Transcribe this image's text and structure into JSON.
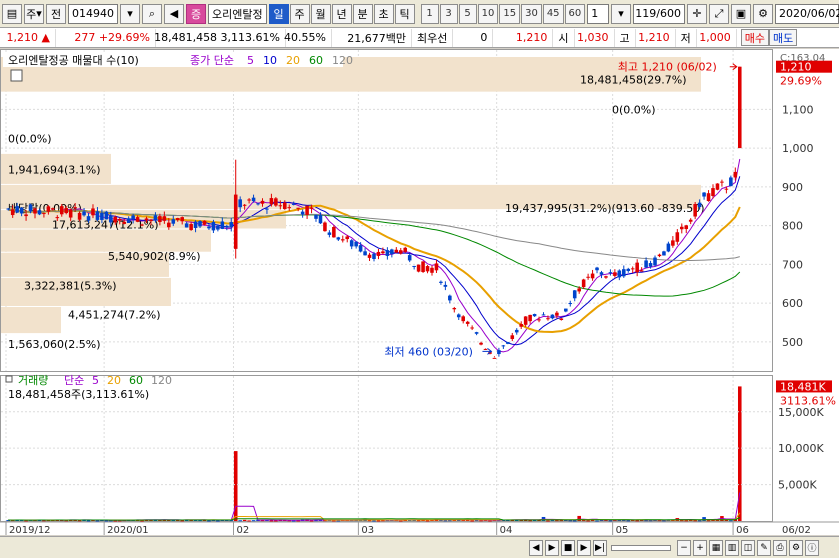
{
  "toolbar": {
    "type_label": "주",
    "all_label": "전",
    "code": "014940",
    "badge": "증",
    "stock_name": "오리엔탈정",
    "periods": [
      "일",
      "주",
      "월",
      "년",
      "분",
      "초",
      "틱"
    ],
    "active_period": "일",
    "intervals": [
      "1",
      "3",
      "5",
      "10",
      "15",
      "30",
      "45",
      "60"
    ],
    "interval_value": "1",
    "count": "119/600",
    "date": "2020/06/02"
  },
  "quote": {
    "price": "1,210",
    "change": "277 +29.69%",
    "volume": "18,481,458 3,113.61%",
    "turnover": "40.55%",
    "amount": "21,677백만",
    "best_label": "최우선",
    "best_value": "0",
    "price2": "1,210",
    "open_label": "시",
    "open": "1,030",
    "high_label": "고",
    "high": "1,210",
    "low_label": "저",
    "low": "1,000",
    "buy_label": "매수",
    "sell_label": "매도"
  },
  "price_panel": {
    "legend_name": "오리엔탈정공 매물대 수(10)",
    "legend_ma_prefix": "종가 단순",
    "legend_ma_periods": [
      "5",
      "10",
      "20",
      "60",
      "120"
    ],
    "legend_ma_colors": [
      "#9900cc",
      "#0000cc",
      "#e8a000",
      "#008800",
      "#888888"
    ],
    "price_tag": "1,210",
    "price_tag_pct": "29.69%",
    "top_clip_label": "C:163.04",
    "high_annotation": "최고 1,210 (06/02)",
    "low_annotation": "최저 460 (03/20)",
    "top_volume_label": "18,481,458(29.7%)",
    "volume_profile_labels": [
      {
        "text": "0(0.0%)",
        "price": 1100
      },
      {
        "text": "0(0.0%)",
        "price": 1025
      },
      {
        "text": "1,941,694(3.1%)",
        "price": 945
      },
      {
        "text": "배당락(0.00%)",
        "price": 845
      },
      {
        "text": "17,613,247(12.1%)",
        "price": 803
      },
      {
        "text": "19,437,995(31.2%)(913.60 -839.50)",
        "price": 845
      },
      {
        "text": "5,540,902(8.9%)",
        "price": 722
      },
      {
        "text": "3,322,381(5.3%)",
        "price": 645
      },
      {
        "text": "4,451,274(7.2%)",
        "price": 570
      },
      {
        "text": "1,563,060(2.5%)",
        "price": 495
      }
    ],
    "y_ticks": [
      {
        "label": "1,100",
        "value": 1100
      },
      {
        "label": "1,000",
        "value": 1000
      },
      {
        "label": "900",
        "value": 900
      },
      {
        "label": "800",
        "value": 800
      },
      {
        "label": "700",
        "value": 700
      },
      {
        "label": "600",
        "value": 600
      },
      {
        "label": "500",
        "value": 500
      }
    ]
  },
  "volume_panel": {
    "legend_name": "거래량",
    "legend_ma_prefix": "단순",
    "legend_ma_periods": [
      "5",
      "20",
      "60",
      "120"
    ],
    "legend_ma_colors": [
      "#9900cc",
      "#e8a000",
      "#008800",
      "#888888"
    ],
    "value_label": "18,481,458주(3,113.61%)",
    "tag": "18,481K",
    "tag_pct": "3113.61%",
    "y_ticks": [
      {
        "label": "15,000K",
        "value": 15000
      },
      {
        "label": "10,000K",
        "value": 10000
      },
      {
        "label": "5,000K",
        "value": 5000
      }
    ]
  },
  "x_labels": [
    {
      "label": "2019/12",
      "index": 0
    },
    {
      "label": "2020/01",
      "index": 22
    },
    {
      "label": "02",
      "index": 51
    },
    {
      "label": "03",
      "index": 79
    },
    {
      "label": "04",
      "index": 110
    },
    {
      "label": "05",
      "index": 136
    },
    {
      "label": "06",
      "index": 163
    }
  ],
  "x_right_label": "06/02",
  "colors": {
    "up": "#e00000",
    "down": "#0044cc",
    "profile": "#f2e2cc",
    "ma5": "#9900cc",
    "ma10": "#0000cc",
    "ma20": "#e8a000",
    "ma60": "#008800",
    "ma120": "#888888"
  }
}
